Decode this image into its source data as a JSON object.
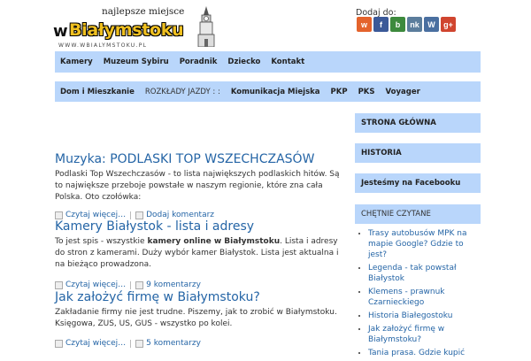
{
  "logo": {
    "tagline": "najlepsze miejsce",
    "prefix": "w",
    "name": "Białymstoku",
    "url": "WWW.WBIALYMSTOKU.PL"
  },
  "share": {
    "label": "Dodaj do:",
    "icons": [
      {
        "name": "wykop-icon",
        "glyph": "w",
        "color": "#e4632c"
      },
      {
        "name": "facebook-icon",
        "glyph": "f",
        "color": "#3b5998"
      },
      {
        "name": "blip-icon",
        "glyph": "b",
        "color": "#3d8a3d"
      },
      {
        "name": "nk-icon",
        "glyph": "nk",
        "color": "#5b7d9c"
      },
      {
        "name": "wordpress-icon",
        "glyph": "W",
        "color": "#4a6fa0"
      },
      {
        "name": "google-plus-icon",
        "glyph": "g+",
        "color": "#d0452f"
      }
    ]
  },
  "nav1": [
    "Kamery",
    "Muzeum Sybiru",
    "Poradnik",
    "Dziecko",
    "Kontakt"
  ],
  "nav2": {
    "home": "Dom i Mieszkanie",
    "timetables": "ROZKŁADY JAZDY : :",
    "items": [
      "Komunikacja Miejska",
      "PKP",
      "PKS",
      "Voyager"
    ]
  },
  "sidebar": {
    "boxes": [
      "STRONA GŁÓWNA",
      "HISTORIA",
      "Jesteśmy na Facebooku"
    ],
    "popular_title": "CHĘTNIE CZYTANE",
    "popular": [
      "Trasy autobusów MPK na mapie Google? Gdzie to jest?",
      "Legenda - tak powstał Białystok",
      "Klemens - prawnuk Czarnieckiego",
      "Historia Białegostoku",
      "Jak założyć firmę w Białymstoku?",
      "Tania prasa. Gdzie kupić"
    ]
  },
  "posts": [
    {
      "title": "Muzyka: PODLASKI TOP WSZECHCZASÓW",
      "text": "Podlaski Top Wszechczasów - to lista największych podlaskich hitów. Są to największe przeboje powstałe w naszym regionie, które zna cała Polska. Oto czołówka:",
      "read_more": "Czytaj więcej…",
      "comments": "Dodaj komentarz"
    },
    {
      "title": "Kamery Białystok - lista i adresy",
      "text_before": "To jest spis - wszystkie ",
      "text_bold": "kamery online w Białymstoku",
      "text_after": ". Lista i adresy do stron z kamerami. Duży wybór kamer Białystok. Lista jest aktualna i na bieżąco prowadzona.",
      "read_more": "Czytaj więcej…",
      "comments": "9 komentarzy"
    },
    {
      "title": "Jak założyć firmę w Białymstoku?",
      "text": "Zakładanie firmy nie jest trudne. Piszemy, jak to zrobić w Białymstoku. Księgowa, ZUS, US, GUS - wszystko po kolei.",
      "read_more": "Czytaj więcej…",
      "comments": "5 komentarzy"
    }
  ]
}
